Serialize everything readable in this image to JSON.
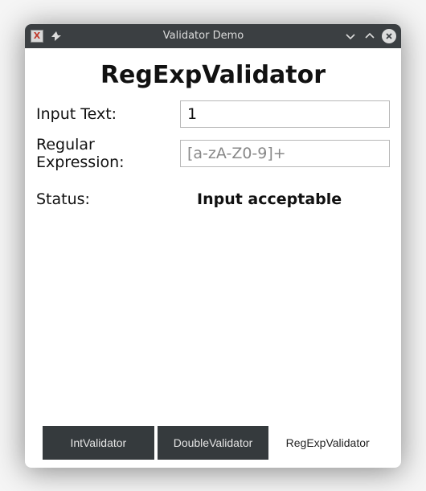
{
  "window": {
    "title": "Validator Demo"
  },
  "heading": "RegExpValidator",
  "form": {
    "input_label": "Input Text:",
    "input_value": "1",
    "regex_label": "Regular Expression:",
    "regex_value": "[a-zA-Z0-9]+"
  },
  "status": {
    "label": "Status:",
    "value": "Input acceptable"
  },
  "tabs": {
    "int": "IntValidator",
    "double": "DoubleValidator",
    "regexp": "RegExpValidator"
  }
}
